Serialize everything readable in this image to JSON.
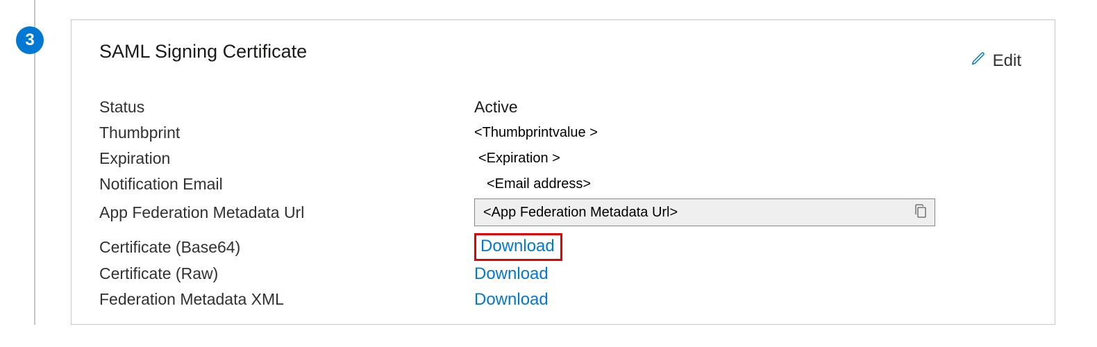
{
  "step": {
    "number": "3"
  },
  "card": {
    "title": "SAML Signing Certificate",
    "edit_label": "Edit"
  },
  "fields": {
    "status": {
      "label": "Status",
      "value": "Active"
    },
    "thumbprint": {
      "label": "Thumbprint",
      "value": "<Thumbprintvalue >"
    },
    "expiration": {
      "label": "Expiration",
      "value": "<Expiration >"
    },
    "notification_email": {
      "label": "Notification Email",
      "value": "<Email address>"
    },
    "app_federation_url": {
      "label": "App Federation Metadata Url",
      "value": "<App Federation Metadata Url>"
    },
    "cert_base64": {
      "label": "Certificate (Base64)",
      "link": "Download"
    },
    "cert_raw": {
      "label": "Certificate (Raw)",
      "link": "Download"
    },
    "fed_metadata_xml": {
      "label": "Federation Metadata XML",
      "link": "Download"
    }
  }
}
